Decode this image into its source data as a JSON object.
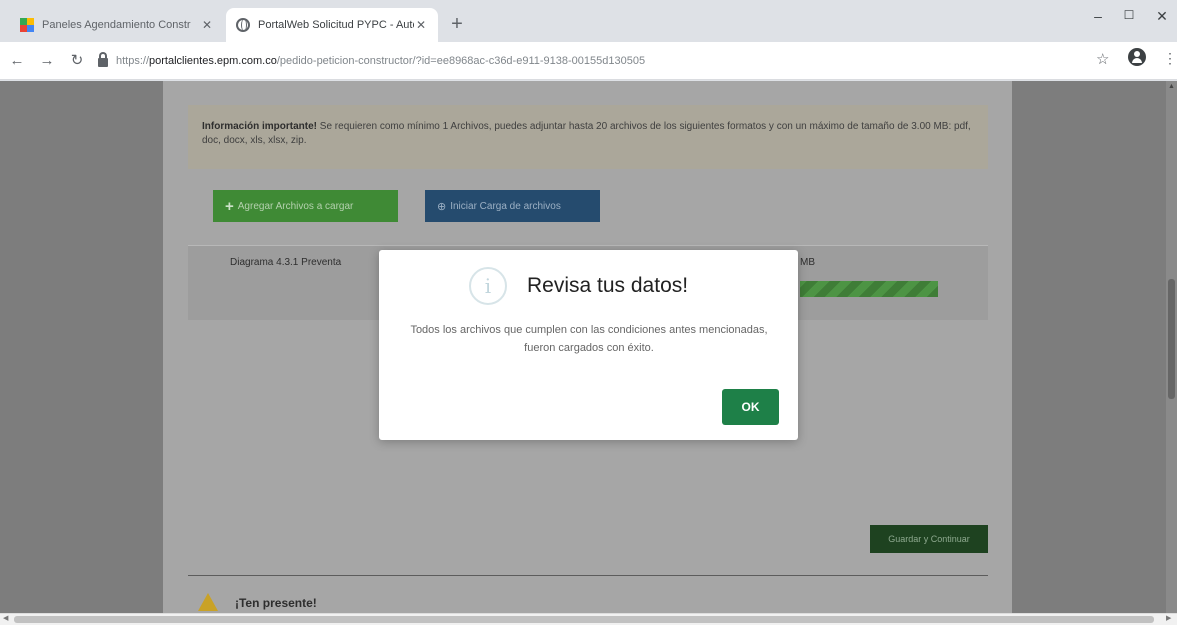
{
  "browser": {
    "tabs": [
      {
        "title": "Paneles Agendamiento Constr",
        "active": false
      },
      {
        "title": "PortalWeb Solicitud PYPC - Autc",
        "active": true
      }
    ],
    "new_tab": "+",
    "window_controls": {
      "minimize": "–",
      "maximize": "☐",
      "close": "✕"
    },
    "nav": {
      "back": "←",
      "forward": "→",
      "reload": "↻"
    },
    "url": {
      "scheme": "https://",
      "domain": "portalclientes.epm.com.co",
      "path": "/pedido-peticion-constructor/?id=ee8968ac-c36d-e911-9138-00155d130505"
    },
    "bookmark_star": "☆",
    "menu": "⋮"
  },
  "page": {
    "info": {
      "heading": "Información importante!",
      "body": " Se requieren como mínimo 1 Archivos, puedes adjuntar hasta 20 archivos de los siguientes formatos y con un máximo de tamaño de 3.00 MB: pdf, doc, docx, xls, xlsx, zip."
    },
    "add_files_button": "Agregar Archivos a cargar",
    "start_upload_button": "Iniciar Carga de archivos",
    "file": {
      "name": "Diagrama 4.3.1 Preventa",
      "size": "MB",
      "progress": 1.0
    },
    "save_button": "Guardar y Continuar",
    "reminder_title": "¡Ten presente!"
  },
  "modal": {
    "icon": "i",
    "title": "Revisa tus datos!",
    "message": "Todos los archivos que cumplen con las condiciones antes mencionadas, fueron cargados con éxito.",
    "ok_button": "OK"
  },
  "colors": {
    "overlay": "#7d7d7d",
    "ok_button": "#1e8048",
    "add_button": "#3f8a35",
    "upload_button": "#254b6e"
  }
}
